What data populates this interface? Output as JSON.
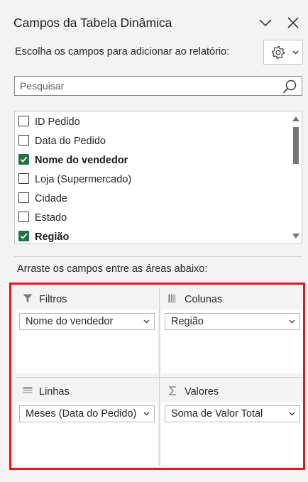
{
  "header": {
    "title": "Campos da Tabela Dinâmica",
    "collapse_icon": "chevron-down-icon",
    "close_icon": "close-icon"
  },
  "subtitle": "Escolha os campos para adicionar ao relatório:",
  "tools_button": {
    "icon": "gear-icon",
    "dropdown_icon": "chevron-down-icon"
  },
  "search": {
    "placeholder": "Pesquisar",
    "value": "",
    "icon": "search-icon"
  },
  "fields": [
    {
      "label": "ID Pedido",
      "checked": false
    },
    {
      "label": "Data do Pedido",
      "checked": false
    },
    {
      "label": "Nome do vendedor",
      "checked": true
    },
    {
      "label": "Loja (Supermercado)",
      "checked": false
    },
    {
      "label": "Cidade",
      "checked": false
    },
    {
      "label": "Estado",
      "checked": false
    },
    {
      "label": "Região",
      "checked": true
    }
  ],
  "drag_hint": "Arraste os campos entre as áreas abaixo:",
  "areas": {
    "filtros": {
      "title": "Filtros",
      "icon": "filter-icon",
      "items": [
        "Nome do vendedor"
      ]
    },
    "colunas": {
      "title": "Colunas",
      "icon": "columns-icon",
      "items": [
        "Região"
      ]
    },
    "linhas": {
      "title": "Linhas",
      "icon": "rows-icon",
      "items": [
        "Meses (Data do Pedido)"
      ]
    },
    "valores": {
      "title": "Valores",
      "icon": "sigma-icon",
      "items": [
        "Soma de Valor Total"
      ]
    }
  },
  "colors": {
    "checkbox_checked": "#217346",
    "highlight_border": "#e2141d",
    "pane_background": "#f3f3f3"
  }
}
